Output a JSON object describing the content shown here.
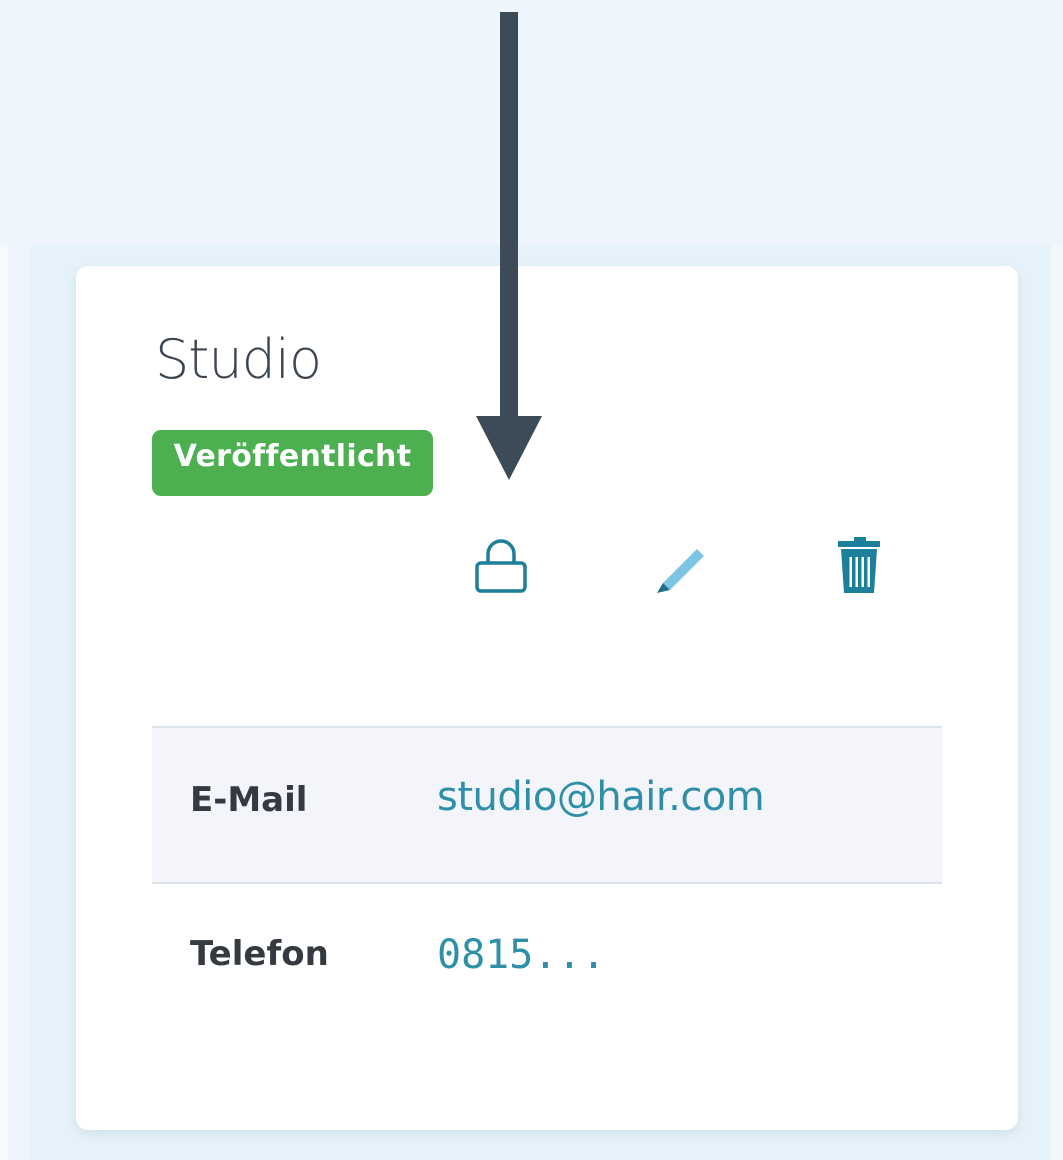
{
  "card": {
    "title": "Studio",
    "status_badge": "Veröffentlicht"
  },
  "actions": {
    "lock": "lock-icon",
    "edit": "pencil-icon",
    "delete": "trash-icon"
  },
  "details": [
    {
      "label": "E-Mail",
      "value": "studio@hair.com"
    },
    {
      "label": "Telefon",
      "value": "0815..."
    }
  ],
  "colors": {
    "badge": "#4caf50",
    "link": "#2e8fa8",
    "icon": "#1d7f99",
    "pencil": "#7cc4e4",
    "arrow": "#3d4b58"
  }
}
